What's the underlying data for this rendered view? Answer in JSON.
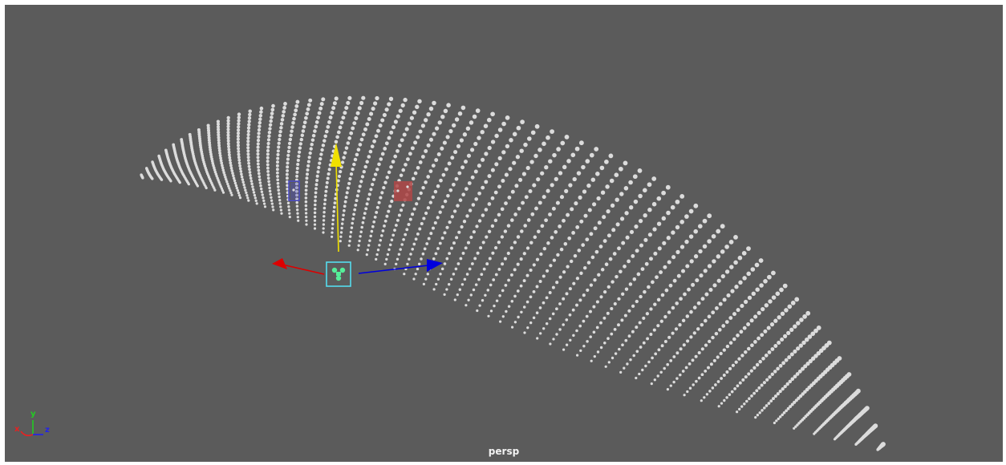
{
  "viewport": {
    "camera_name": "persp",
    "background_color": "#5b5b5b",
    "point_color": "#dcdcdc"
  },
  "axis_indicator": {
    "x_label": "x",
    "y_label": "y",
    "z_label": "z",
    "x_color": "#e52222",
    "y_color": "#22cc22",
    "z_color": "#2222ee"
  },
  "manipulator": {
    "type": "move-tool",
    "x_color": "#dd0000",
    "y_color": "#f0e000",
    "z_color": "#0000dd",
    "center_color": "#55ddee",
    "center_icon": "hotkey-icon"
  },
  "handles": {
    "blue_handle_color": "#4a4acc",
    "red_handle_color": "#b04848"
  }
}
